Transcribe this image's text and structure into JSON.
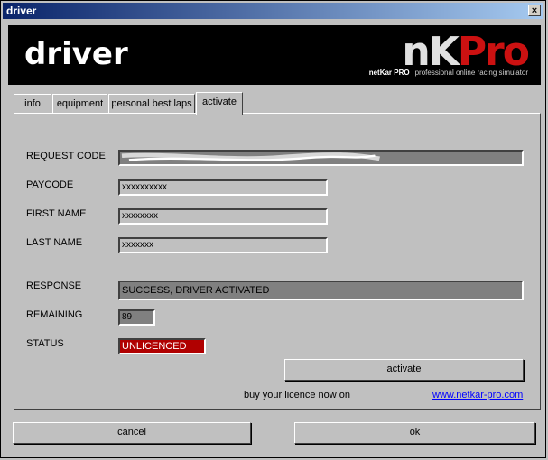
{
  "window": {
    "title": "driver",
    "close_label": "×"
  },
  "header": {
    "title": "driver",
    "logo_main_left": "nK",
    "logo_main_right": "Pro",
    "logo_brand_small": "netKar PRO",
    "logo_tagline": "professional online racing simulator"
  },
  "tabs": [
    {
      "label": "info"
    },
    {
      "label": "equipment"
    },
    {
      "label": "personal best laps"
    },
    {
      "label": "activate",
      "active": true
    }
  ],
  "form": {
    "request_code_label": "REQUEST CODE",
    "request_code_value": "",
    "paycode_label": "PAYCODE",
    "paycode_value": "xxxxxxxxxx",
    "first_name_label": "FIRST NAME",
    "first_name_value": "xxxxxxxx",
    "last_name_label": "LAST NAME",
    "last_name_value": "xxxxxxx",
    "response_label": "RESPONSE",
    "response_value": "SUCCESS, DRIVER ACTIVATED",
    "remaining_label": "REMAINING",
    "remaining_value": "89",
    "status_label": "STATUS",
    "status_value": "UNLICENCED",
    "status_color": "#b00000"
  },
  "activate_button": "activate",
  "buy": {
    "text": "buy your licence now on",
    "link": "www.netkar-pro.com"
  },
  "footer": {
    "cancel": "cancel",
    "ok": "ok"
  }
}
